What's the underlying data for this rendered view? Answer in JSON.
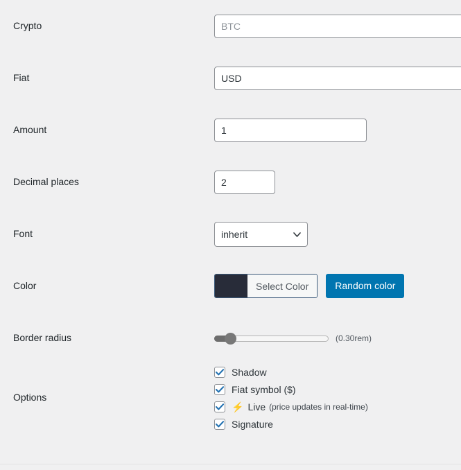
{
  "theme": {
    "background": "#f0f0f1",
    "accent_blue": "#0075b0",
    "checkbox_blue": "#2271b1",
    "label_color": "#1d2327",
    "swatch_color": "#282c39",
    "bolt_color": "#f5a623"
  },
  "rows": {
    "crypto": {
      "label": "Crypto",
      "placeholder": "BTC",
      "value": ""
    },
    "fiat": {
      "label": "Fiat",
      "placeholder": "",
      "value": "USD"
    },
    "amount": {
      "label": "Amount",
      "value": "1"
    },
    "decimal_places": {
      "label": "Decimal places",
      "value": "2"
    },
    "font": {
      "label": "Font",
      "selected": "inherit",
      "options": [
        "inherit"
      ],
      "arrow_icon": "chevron-down-icon"
    },
    "color": {
      "label": "Color",
      "swatch": "#282c39",
      "select_label": "Select Color",
      "random_label": "Random color"
    },
    "border_radius": {
      "label": "Border radius",
      "value_text": "(0.30rem)",
      "slider_percent": 16
    },
    "options": {
      "label": "Options",
      "items": [
        {
          "label": "Shadow",
          "checked": true,
          "icon": "",
          "note": ""
        },
        {
          "label": "Fiat symbol ($)",
          "checked": true,
          "icon": "",
          "note": ""
        },
        {
          "label": "Live",
          "checked": true,
          "icon": "⚡",
          "note": "(price updates in real-time)"
        },
        {
          "label": "Signature",
          "checked": true,
          "icon": "",
          "note": ""
        }
      ]
    }
  }
}
